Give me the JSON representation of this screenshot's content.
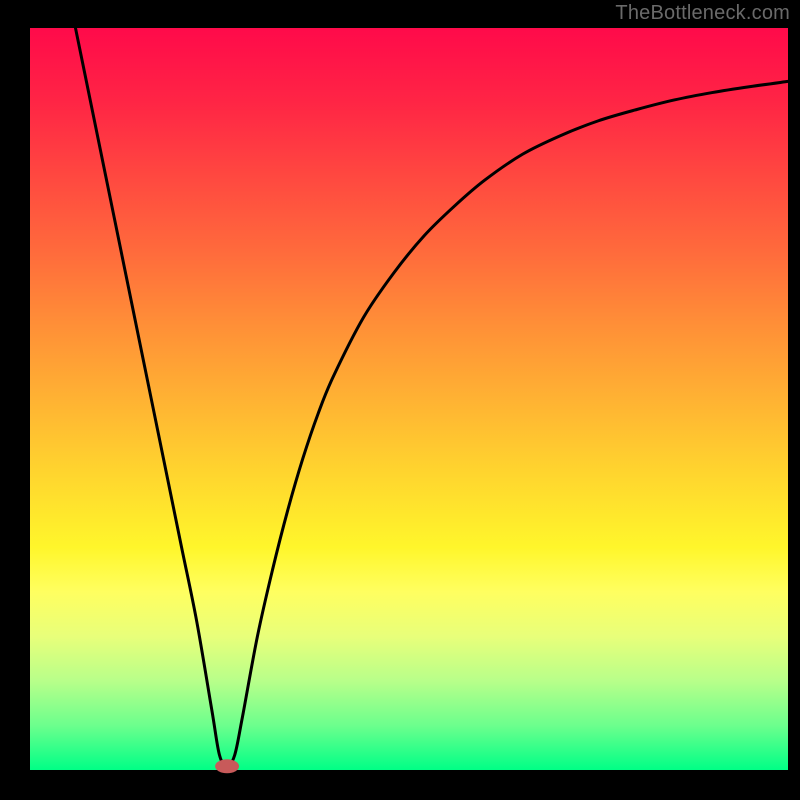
{
  "watermark": "TheBottleneck.com",
  "colors": {
    "black": "#000000",
    "line_stroke": "#000000",
    "marker_fill": "#c85a5a",
    "gradient": [
      {
        "offset": 0.0,
        "color": "#ff0a4a"
      },
      {
        "offset": 0.1,
        "color": "#ff2545"
      },
      {
        "offset": 0.2,
        "color": "#ff4840"
      },
      {
        "offset": 0.3,
        "color": "#ff6a3c"
      },
      {
        "offset": 0.4,
        "color": "#ff8f37"
      },
      {
        "offset": 0.5,
        "color": "#ffb233"
      },
      {
        "offset": 0.6,
        "color": "#ffd52e"
      },
      {
        "offset": 0.7,
        "color": "#fff62b"
      },
      {
        "offset": 0.76,
        "color": "#ffff60"
      },
      {
        "offset": 0.82,
        "color": "#e8ff7a"
      },
      {
        "offset": 0.88,
        "color": "#b8ff8a"
      },
      {
        "offset": 0.94,
        "color": "#6cff8d"
      },
      {
        "offset": 1.0,
        "color": "#00ff86"
      }
    ]
  },
  "chart_data": {
    "type": "line",
    "title": "",
    "xlabel": "",
    "ylabel": "",
    "xlim": [
      0,
      100
    ],
    "ylim": [
      0,
      100
    ],
    "grid": false,
    "legend": false,
    "annotations": [],
    "series": [
      {
        "name": "curve",
        "x": [
          6,
          8,
          10,
          12,
          14,
          16,
          18,
          20,
          22,
          24,
          25,
          26,
          27,
          28,
          30,
          32,
          34,
          36,
          38,
          40,
          44,
          48,
          52,
          56,
          60,
          65,
          70,
          75,
          80,
          85,
          90,
          95,
          100
        ],
        "y": [
          100,
          90,
          80,
          70,
          60,
          50,
          40,
          30,
          20,
          8,
          2,
          0.5,
          2,
          7,
          18,
          27,
          35,
          42,
          48,
          53,
          61,
          67,
          72,
          76,
          79.5,
          83,
          85.5,
          87.5,
          89,
          90.3,
          91.3,
          92.1,
          92.8
        ]
      }
    ],
    "min_marker": {
      "x": 26,
      "y": 0.5
    }
  }
}
